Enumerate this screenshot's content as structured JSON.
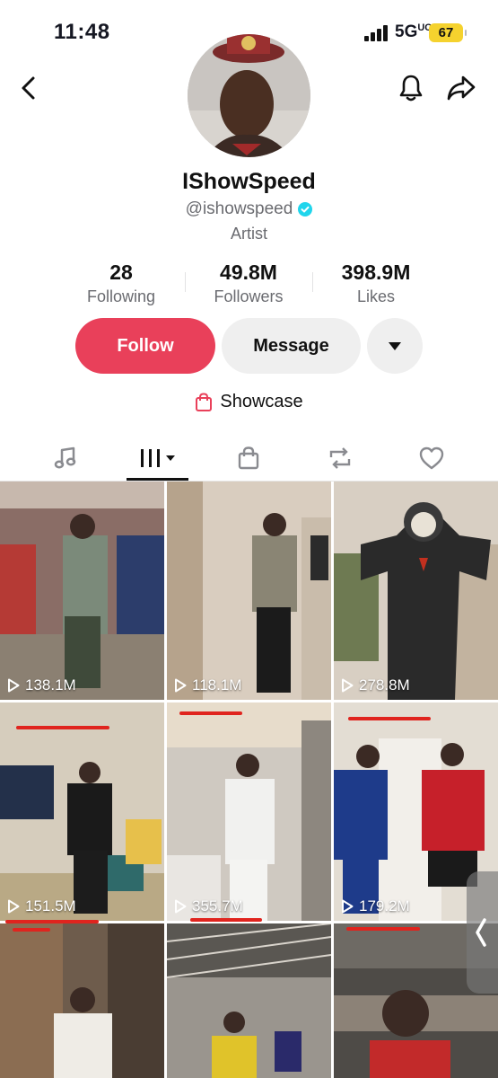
{
  "status_bar": {
    "time": "11:48",
    "network": "5G",
    "network_suffix": "UC",
    "battery": "67"
  },
  "header": {
    "back_icon": "chevron-left-icon",
    "bell_icon": "bell-icon",
    "share_icon": "share-arrow-icon"
  },
  "profile": {
    "name": "IShowSpeed",
    "handle": "@ishowspeed",
    "category": "Artist",
    "stats": [
      {
        "value": "28",
        "label": "Following"
      },
      {
        "value": "49.8M",
        "label": "Followers"
      },
      {
        "value": "398.9M",
        "label": "Likes"
      }
    ]
  },
  "actions": {
    "follow": "Follow",
    "message": "Message",
    "more_icon": "caret-down-icon"
  },
  "showcase": {
    "label": "Showcase",
    "icon": "shopping-bag-icon"
  },
  "tabs": [
    {
      "icon": "music-note-icon"
    },
    {
      "icon": "grid-videos-icon",
      "active": true
    },
    {
      "icon": "shopping-bag-icon"
    },
    {
      "icon": "repost-icon"
    },
    {
      "icon": "heart-icon"
    }
  ],
  "videos": [
    {
      "views": "138.1M"
    },
    {
      "views": "118.1M"
    },
    {
      "views": "278.8M"
    },
    {
      "views": "151.5M"
    },
    {
      "views": "355.7M"
    },
    {
      "views": "179.2M"
    },
    {
      "views": ""
    },
    {
      "views": ""
    },
    {
      "views": ""
    }
  ],
  "colors": {
    "follow": "#e9405a",
    "verified": "#20d5ec",
    "text_secondary": "#6a6b70",
    "annotation": "#e0241e"
  }
}
